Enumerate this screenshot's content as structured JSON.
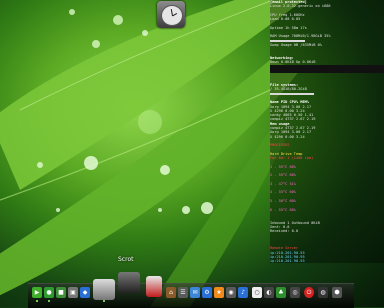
{
  "conky": {
    "lines": [
      {
        "text": "[email protected]",
        "cls": "hdr"
      },
      {
        "text": "Linux 2.6.32-generic on i686",
        "cls": ""
      },
      {
        "text": "",
        "cls": ""
      },
      {
        "text": "CPU freq  1.60GHz",
        "cls": ""
      },
      {
        "text": "Load  0.08 0.05",
        "cls": ""
      },
      {
        "text": "",
        "cls": ""
      },
      {
        "text": "Uptime  1h 58m 17s",
        "cls": ""
      },
      {
        "text": "",
        "cls": ""
      },
      {
        "text": "RAM Usage  708MiB/1.98GiB  35%",
        "cls": ""
      },
      {
        "text": "Swap Usage  0B /635MiB  0%",
        "cls": ""
      },
      {
        "text": "",
        "cls": ""
      },
      {
        "text": "Networking:",
        "cls": "hdr"
      },
      {
        "text": "Down 0.0KiB   Up 0.0KiB",
        "cls": ""
      },
      {
        "text": "",
        "cls": ""
      },
      {
        "text": "",
        "cls": ""
      },
      {
        "text": "File systems:",
        "cls": "hdr"
      },
      {
        "text": "/  35.4GiB/80.2GiB",
        "cls": ""
      },
      {
        "text": "",
        "cls": ""
      },
      {
        "text": "Name          PID  CPU%  MEM%",
        "cls": "hdr"
      },
      {
        "text": "Xorg          1094  3.00  2.17",
        "cls": ""
      },
      {
        "text": "X             4296  0.00  3.24",
        "cls": ""
      },
      {
        "text": "conky         4065  0.50  1.41",
        "cls": ""
      },
      {
        "text": "compiz        4737  2.67  2.19",
        "cls": ""
      },
      {
        "text": "Mem usage",
        "cls": "hdr"
      },
      {
        "text": "compiz        4737  2.67  2.19",
        "cls": ""
      },
      {
        "text": "Xorg          1094  3.00  2.17",
        "cls": ""
      },
      {
        "text": "X             4296  0.00  3.24",
        "cls": ""
      },
      {
        "text": "",
        "cls": ""
      },
      {
        "text": "PROCESSES",
        "cls": "red"
      },
      {
        "text": "",
        "cls": ""
      },
      {
        "text": "Hard Drive Temp",
        "cls": "yellow"
      },
      {
        "text": "Fan Bd: 1 (1400 rpm)",
        "cls": "red"
      },
      {
        "text": "",
        "cls": ""
      },
      {
        "text": "1 - 55°C  60%",
        "cls": "magenta"
      },
      {
        "text": "",
        "cls": ""
      },
      {
        "text": "2 - 55°C  60%",
        "cls": "magenta"
      },
      {
        "text": "",
        "cls": ""
      },
      {
        "text": "3 - 47°C  51%",
        "cls": "magenta"
      },
      {
        "text": "",
        "cls": ""
      },
      {
        "text": "4 - 55°C  60%",
        "cls": "magenta"
      },
      {
        "text": "",
        "cls": ""
      },
      {
        "text": "5 - 50°C  60%",
        "cls": "magenta"
      },
      {
        "text": "",
        "cls": ""
      },
      {
        "text": "6 - 55°C  60%",
        "cls": "magenta"
      },
      {
        "text": "",
        "cls": ""
      },
      {
        "text": "",
        "cls": ""
      },
      {
        "text": "Inbound 1  Outbound 0KiB",
        "cls": ""
      },
      {
        "text": "Sent: 0.0",
        "cls": ""
      },
      {
        "text": "Received: 0.0",
        "cls": ""
      },
      {
        "text": "",
        "cls": ""
      },
      {
        "text": "",
        "cls": ""
      },
      {
        "text": "",
        "cls": ""
      },
      {
        "text": "Remote Server",
        "cls": "red"
      },
      {
        "text": "ip:210.201.90.55",
        "cls": "cyan"
      },
      {
        "text": "ip:210.201.90.95",
        "cls": "cyan"
      },
      {
        "text": "ip:210.201.90.55",
        "cls": "cyan"
      }
    ],
    "ram_fraction": 0.35,
    "swap_fraction": 0.0,
    "fs_fraction": 0.44
  },
  "dock": {
    "tooltip": "Scrot",
    "colors": {
      "green": "#3fae2a",
      "blue": "#2a6fd6",
      "red": "#d32323",
      "gray": "#8a8a8a",
      "orange": "#f08a1c"
    }
  }
}
